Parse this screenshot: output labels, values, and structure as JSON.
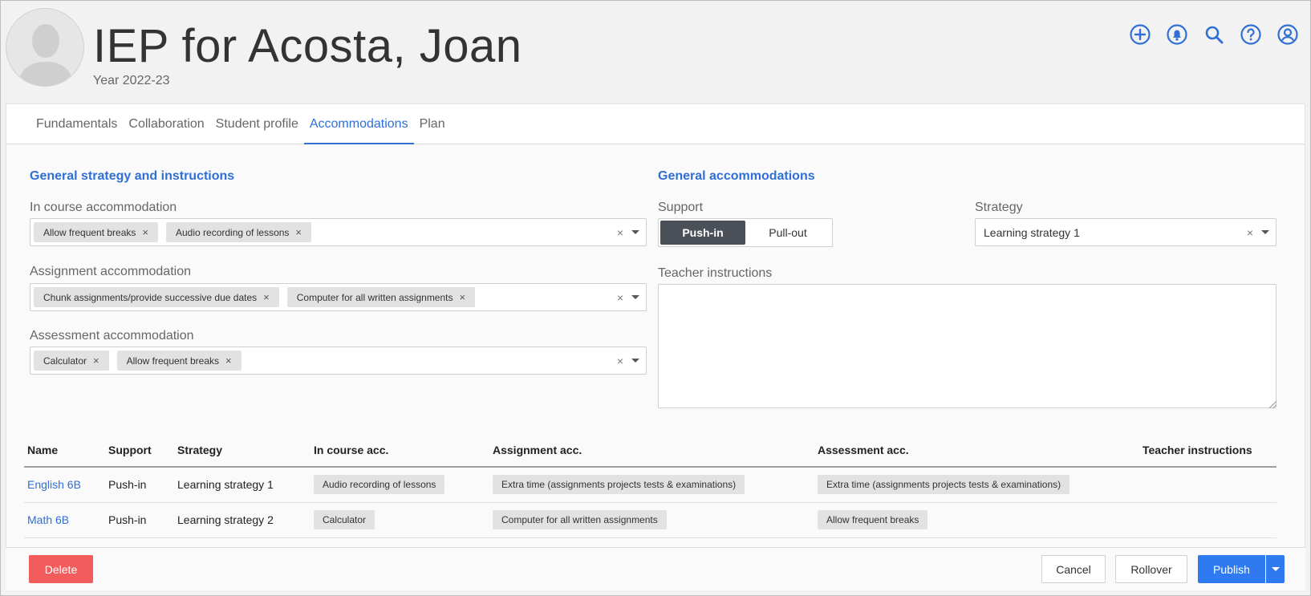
{
  "header": {
    "title": "IEP for Acosta, Joan",
    "subtitle": "Year 2022-23",
    "icons": [
      "add-circle-icon",
      "bell-icon",
      "search-icon",
      "help-icon",
      "account-icon"
    ],
    "accent": "#2f6fd6"
  },
  "tabs": [
    {
      "label": "Fundamentals"
    },
    {
      "label": "Collaboration"
    },
    {
      "label": "Student profile"
    },
    {
      "label": "Accommodations",
      "active": true
    },
    {
      "label": "Plan"
    }
  ],
  "general": {
    "title": "General strategy and instructions",
    "in_course": {
      "label": "In course accommodation",
      "chips": [
        "Allow frequent breaks",
        "Audio recording of lessons"
      ]
    },
    "assignment": {
      "label": "Assignment accommodation",
      "chips": [
        "Chunk assignments/provide successive due dates",
        "Computer for all written assignments"
      ]
    },
    "assessment": {
      "label": "Assessment accommodation",
      "chips": [
        "Calculator",
        "Allow frequent breaks"
      ]
    }
  },
  "accommodations": {
    "title": "General accommodations",
    "support_label": "Support",
    "support_options": [
      "Push-in",
      "Pull-out"
    ],
    "support_selected": "Push-in",
    "strategy_label": "Strategy",
    "strategy_value": "Learning strategy 1",
    "teacher_label": "Teacher instructions",
    "teacher_value": ""
  },
  "table": {
    "headers": [
      "Name",
      "Support",
      "Strategy",
      "In course acc.",
      "Assignment acc.",
      "Assessment acc.",
      "Teacher instructions"
    ],
    "rows": [
      {
        "name": "English 6B",
        "support": "Push-in",
        "strategy": "Learning strategy 1",
        "in_course": "Audio recording of lessons",
        "assignment": "Extra time (assignments projects tests & examinations)",
        "assessment": "Extra time (assignments projects tests & examinations)",
        "teacher": ""
      },
      {
        "name": "Math 6B",
        "support": "Push-in",
        "strategy": "Learning strategy 2",
        "in_course": "Calculator",
        "assignment": "Computer for all written assignments",
        "assessment": "Allow frequent breaks",
        "teacher": ""
      }
    ]
  },
  "footer": {
    "delete": "Delete",
    "cancel": "Cancel",
    "rollover": "Rollover",
    "publish": "Publish",
    "delete_color": "#f25c5c",
    "publish_color": "#2f7af0"
  }
}
